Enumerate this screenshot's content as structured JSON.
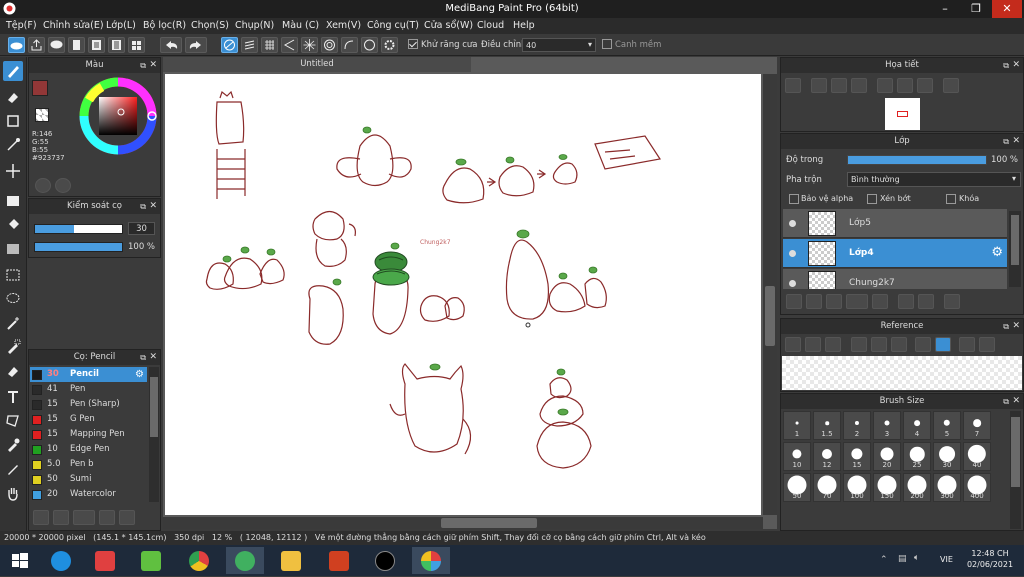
{
  "window": {
    "title": "MediBang Paint Pro (64bit)"
  },
  "menu": [
    "Tệp(F)",
    "Chỉnh sửa(E)",
    "Lớp(L)",
    "Bộ lọc(R)",
    "Chọn(S)",
    "Chụp(N)",
    "Màu (C)",
    "Xem(V)",
    "Công cụ(T)",
    "Cửa sổ(W)",
    "Cloud",
    "Help"
  ],
  "toolbar": {
    "antialias_label": "Khử răng cưa",
    "antialias_checked": true,
    "correction_label": "Điều chỉnh",
    "correction_value": "40",
    "snap_label": "Canh mềm",
    "snap_checked": false
  },
  "color_panel": {
    "title": "Màu",
    "r": "R:146",
    "g": "G:55",
    "b": "B:55",
    "hex": "#923737",
    "main_color": "#923737"
  },
  "brush_control": {
    "title": "Kiểm soát cọ",
    "size": "30",
    "size_fraction": 0.45,
    "opacity": "100 %",
    "opacity_fraction": 1.0
  },
  "brush_panel": {
    "title": "Cọ: Pencil",
    "brushes": [
      {
        "size": "30",
        "name": "Pencil",
        "color": "#1a1a1a",
        "selected": true
      },
      {
        "size": "41",
        "name": "Pen",
        "color": "#2a2a2a"
      },
      {
        "size": "15",
        "name": "Pen (Sharp)",
        "color": "#2a2a2a"
      },
      {
        "size": "15",
        "name": "G Pen",
        "color": "#e02020"
      },
      {
        "size": "15",
        "name": "Mapping Pen",
        "color": "#e02020"
      },
      {
        "size": "10",
        "name": "Edge Pen",
        "color": "#20a020"
      },
      {
        "size": "5.0",
        "name": "Pen b",
        "color": "#e0d020"
      },
      {
        "size": "50",
        "name": "Sumi",
        "color": "#e0d020"
      },
      {
        "size": "20",
        "name": "Watercolor",
        "color": "#40a0e0"
      }
    ]
  },
  "canvas": {
    "tab": "Untitled",
    "watermark": "Chung2k7"
  },
  "navigator": {
    "title": "Họa tiết"
  },
  "layer_panel": {
    "title": "Lớp",
    "opacity_label": "Độ trong",
    "opacity_value": "100 %",
    "opacity_fraction": 1.0,
    "blend_label": "Pha trộn",
    "blend_value": "Bình thường",
    "protect_alpha": "Bảo vệ alpha",
    "clipping": "Xén bớt",
    "lock": "Khóa",
    "layers": [
      {
        "name": "Lớp5",
        "selected": false
      },
      {
        "name": "Lớp4",
        "selected": true
      },
      {
        "name": "Chung2k7",
        "selected": false
      }
    ]
  },
  "reference": {
    "title": "Reference"
  },
  "brush_size": {
    "title": "Brush Size",
    "sizes": [
      "1",
      "1.5",
      "2",
      "3",
      "4",
      "5",
      "7",
      "10",
      "12",
      "15",
      "20",
      "25",
      "30",
      "40",
      "50",
      "70",
      "100",
      "150",
      "200",
      "300",
      "400"
    ]
  },
  "status": {
    "dimensions": "20000 * 20000 pixel",
    "physical": "(145.1 * 145.1cm)",
    "dpi": "350 dpi",
    "zoom": "12 %",
    "coords": "( 12048, 12112 )",
    "hint": "Vẽ một đường thẳng bằng cách giữ phím Shift, Thay đổi cỡ cọ bằng cách giữ phím Ctrl, Alt và kéo"
  },
  "taskbar": {
    "time": "12:48 CH",
    "date": "02/06/2021",
    "lang": "VIE"
  }
}
